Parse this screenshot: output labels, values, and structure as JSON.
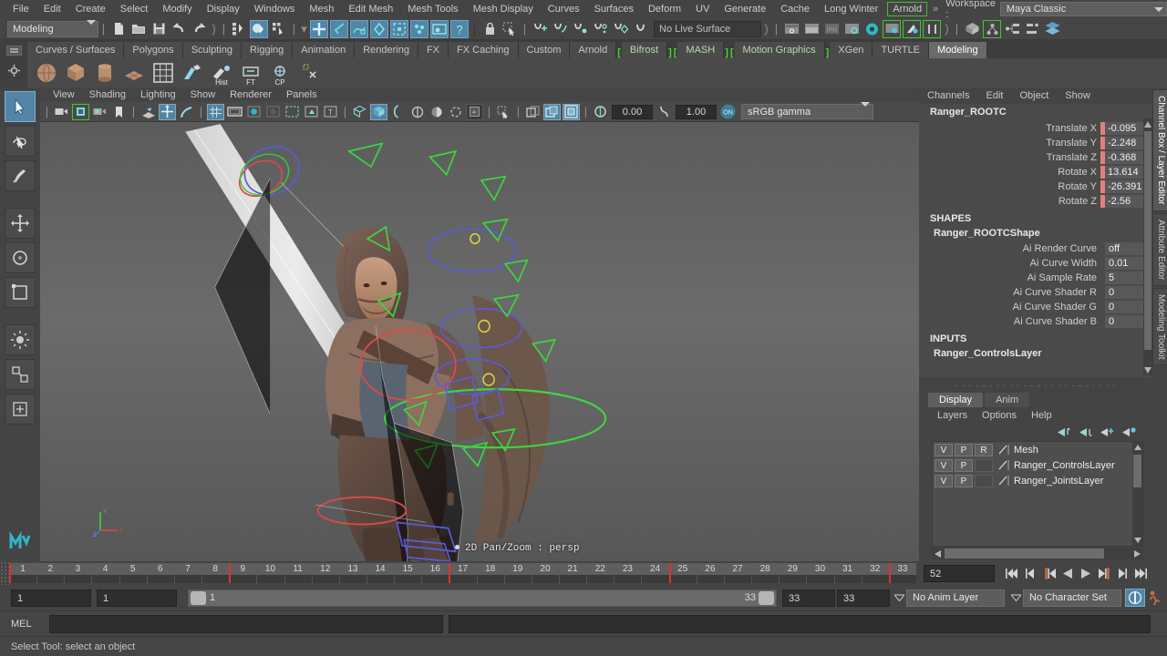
{
  "menubar": {
    "items": [
      "File",
      "Edit",
      "Create",
      "Select",
      "Modify",
      "Display",
      "Windows",
      "Mesh",
      "Edit Mesh",
      "Mesh Tools",
      "Mesh Display",
      "Curves",
      "Surfaces",
      "Deform",
      "UV",
      "Generate",
      "Cache",
      "Long Winter"
    ],
    "highlighted_item": "Arnold",
    "chevron": "»",
    "workspace_label": "Workspace :",
    "workspace_value": "Maya Classic"
  },
  "statusline": {
    "mode_value": "Modeling",
    "live_surface": "No Live Surface",
    "icons": [
      "select-by-hierarchy-icon",
      "select-by-object-icon",
      "select-by-component-icon",
      "mask-all-icon",
      "mask-handles-icon",
      "mask-curves-icon",
      "mask-surfaces-icon",
      "mask-deformations-icon",
      "mask-dynamics-icon",
      "mask-rendering-icon",
      "mask-misc-icon",
      "lock-icon",
      "snap-grid-icon",
      "snap-curve-icon",
      "snap-point-icon",
      "snap-projected-icon",
      "snap-view-plane-icon",
      "snap-disable-icon"
    ]
  },
  "shelf": {
    "tabs": [
      {
        "label": "Curves / Surfaces",
        "active": false,
        "bracket": false
      },
      {
        "label": "Polygons",
        "active": false,
        "bracket": false
      },
      {
        "label": "Sculpting",
        "active": false,
        "bracket": false
      },
      {
        "label": "Rigging",
        "active": false,
        "bracket": false
      },
      {
        "label": "Animation",
        "active": false,
        "bracket": false
      },
      {
        "label": "Rendering",
        "active": false,
        "bracket": false
      },
      {
        "label": "FX",
        "active": false,
        "bracket": false
      },
      {
        "label": "FX Caching",
        "active": false,
        "bracket": false
      },
      {
        "label": "Custom",
        "active": false,
        "bracket": false
      },
      {
        "label": "Arnold",
        "active": false,
        "bracket": false
      },
      {
        "label": "Bifrost",
        "active": false,
        "bracket": true
      },
      {
        "label": "MASH",
        "active": false,
        "bracket": true
      },
      {
        "label": "Motion Graphics",
        "active": false,
        "bracket": true
      },
      {
        "label": "XGen",
        "active": false,
        "bracket": false
      },
      {
        "label": "TURTLE",
        "active": false,
        "bracket": false
      },
      {
        "label": "Modeling",
        "active": true,
        "bracket": false
      }
    ],
    "buttons": [
      {
        "name": "poly-sphere-icon",
        "label": ""
      },
      {
        "name": "poly-cube-icon",
        "label": ""
      },
      {
        "name": "poly-cylinder-icon",
        "label": ""
      },
      {
        "name": "poly-plane-icon",
        "label": ""
      },
      {
        "name": "grid-icon",
        "label": ""
      },
      {
        "name": "bevel-icon",
        "label": ""
      },
      {
        "name": "history-icon",
        "label": "Hist"
      },
      {
        "name": "freeze-transform-icon",
        "label": "FT"
      },
      {
        "name": "center-pivot-icon",
        "label": "CP"
      },
      {
        "name": "delete-icon",
        "label": ""
      }
    ]
  },
  "toolbox": {
    "tools": [
      "select-tool",
      "lasso-tool",
      "paint-select-tool",
      "move-tool",
      "rotate-tool",
      "scale-tool",
      "soft-select-tool",
      "show-manipulator-tool",
      "last-tool"
    ],
    "logo": "maya-logo"
  },
  "viewport": {
    "menus": [
      "View",
      "Shading",
      "Lighting",
      "Show",
      "Renderer",
      "Panels"
    ],
    "exposure": "0.00",
    "gamma": "1.00",
    "gamma_toggle": "ON",
    "color_space": "sRGB gamma",
    "hud_text": "2D Pan/Zoom : persp",
    "axis_labels": {
      "y": "Y",
      "x": "X",
      "z": "Z"
    }
  },
  "channelbox": {
    "menus": [
      "Channels",
      "Edit",
      "Object",
      "Show"
    ],
    "object_name": "Ranger_ROOTC",
    "transform_channels": [
      {
        "label": "Translate X",
        "value": "-0.095",
        "keyed": true
      },
      {
        "label": "Translate Y",
        "value": "-2.248",
        "keyed": true
      },
      {
        "label": "Translate Z",
        "value": "-0.368",
        "keyed": true
      },
      {
        "label": "Rotate X",
        "value": "13.614",
        "keyed": true
      },
      {
        "label": "Rotate Y",
        "value": "-26.391",
        "keyed": true
      },
      {
        "label": "Rotate Z",
        "value": "-2.56",
        "keyed": true
      }
    ],
    "shapes_header": "SHAPES",
    "shape_name": "Ranger_ROOTCShape",
    "shape_channels": [
      {
        "label": "Ai Render Curve",
        "value": "off"
      },
      {
        "label": "Ai Curve Width",
        "value": "0.01"
      },
      {
        "label": "Ai Sample Rate",
        "value": "5"
      },
      {
        "label": "Ai Curve Shader R",
        "value": "0"
      },
      {
        "label": "Ai Curve Shader G",
        "value": "0"
      },
      {
        "label": "Ai Curve Shader B",
        "value": "0"
      }
    ],
    "inputs_header": "INPUTS",
    "input_name": "Ranger_ControlsLayer"
  },
  "layer_editor": {
    "tabs": [
      {
        "label": "Display",
        "active": true
      },
      {
        "label": "Anim",
        "active": false
      }
    ],
    "menus": [
      "Layers",
      "Options",
      "Help"
    ],
    "toolbar_icons": [
      "move-layer-up-icon",
      "move-layer-down-icon",
      "new-layer-icon",
      "new-layer-from-selected-icon"
    ],
    "columns": [
      "V",
      "P",
      "R"
    ],
    "layers": [
      {
        "v": "V",
        "p": "P",
        "r": "R",
        "name": "Mesh",
        "selected": false
      },
      {
        "v": "V",
        "p": "P",
        "r": "",
        "name": "Ranger_ControlsLayer",
        "selected": false
      },
      {
        "v": "V",
        "p": "P",
        "r": "",
        "name": "Ranger_JointsLayer",
        "selected": false
      }
    ]
  },
  "sidetabs": [
    {
      "label": "Channel Box / Layer Editor",
      "active": true
    },
    {
      "label": "Attribute Editor",
      "active": false
    },
    {
      "label": "Modeling Toolkit",
      "active": false
    }
  ],
  "timeline": {
    "frames": [
      1,
      2,
      3,
      4,
      5,
      6,
      7,
      8,
      9,
      10,
      11,
      12,
      13,
      14,
      15,
      16,
      17,
      18,
      19,
      20,
      21,
      22,
      23,
      24,
      25,
      26,
      27,
      28,
      29,
      30,
      31,
      32,
      33
    ],
    "keyframes": [
      1,
      9,
      17,
      25,
      33
    ],
    "current_frame": "52",
    "playback_buttons": [
      "go-to-start-icon",
      "step-back-keyframe-icon",
      "step-back-frame-icon",
      "play-backwards-icon",
      "play-forwards-icon",
      "step-forward-frame-icon",
      "step-forward-keyframe-icon",
      "go-to-end-icon"
    ]
  },
  "range": {
    "anim_start": "1",
    "range_start": "1",
    "slider_start": "1",
    "slider_end": "33",
    "range_end": "33",
    "anim_end": "33",
    "anim_layer": "No Anim Layer",
    "character_set": "No Character Set",
    "auto_key_icon": "auto-key-icon",
    "prefs_icon": "animation-preferences-icon"
  },
  "command": {
    "mel_label": "MEL",
    "input_value": "",
    "placeholder": ""
  },
  "helpline": {
    "text": "Select Tool: select an object"
  },
  "colors": {
    "accent_blue": "#5285a6",
    "accent_green": "#43c52c",
    "key_pink": "#e08080",
    "keyframe_red": "#e03030",
    "bg": "#444444"
  }
}
